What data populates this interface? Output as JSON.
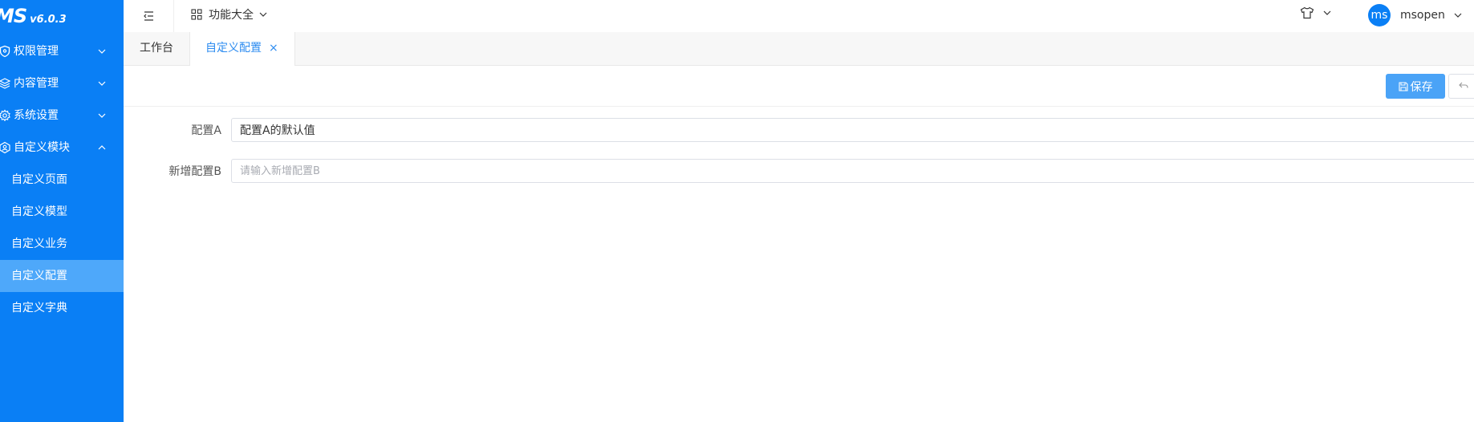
{
  "logo": {
    "mark": "MS",
    "version": "v6.0.3"
  },
  "sidebar": {
    "items": [
      {
        "label": "权限管理",
        "icon": "shield-icon",
        "expanded": false
      },
      {
        "label": "内容管理",
        "icon": "layers-icon",
        "expanded": false
      },
      {
        "label": "系统设置",
        "icon": "gear-icon",
        "expanded": false
      },
      {
        "label": "自定义模块",
        "icon": "module-icon",
        "expanded": true
      }
    ],
    "subitems": [
      {
        "label": "自定义页面"
      },
      {
        "label": "自定义模型"
      },
      {
        "label": "自定义业务"
      },
      {
        "label": "自定义配置",
        "active": true
      },
      {
        "label": "自定义字典"
      }
    ]
  },
  "topbar": {
    "func_menu_label": "功能大全",
    "user": {
      "avatar_text": "ms",
      "name": "msopen"
    }
  },
  "tabs": [
    {
      "label": "工作台"
    },
    {
      "label": "自定义配置",
      "active": true,
      "close": "×"
    }
  ],
  "toolbar": {
    "save_label": "保存"
  },
  "form": {
    "fields": [
      {
        "label": "配置A",
        "value": "配置A的默认值",
        "placeholder": ""
      },
      {
        "label": "新增配置B",
        "value": "",
        "placeholder": "请输入新增配置B"
      }
    ]
  },
  "colors": {
    "primary": "#0a7ff5",
    "active_submenu": "#4ea8fa",
    "button": "#4aa3f7",
    "tab_active_text": "#2d8cf0"
  }
}
